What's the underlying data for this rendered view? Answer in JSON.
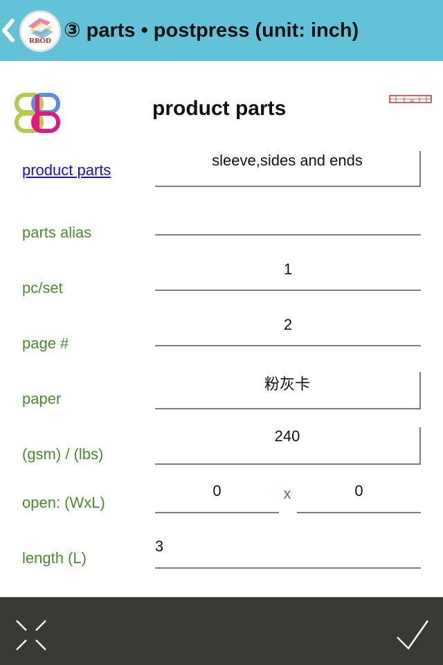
{
  "header": {
    "title": "③ parts • postpress (unit: inch)",
    "logo_text": "RBOD",
    "accent_color": "#62c2d7"
  },
  "content": {
    "page_title": "product parts"
  },
  "form": {
    "product_parts": {
      "label": "product parts",
      "value": "sleeve,sides and ends"
    },
    "parts_alias": {
      "label": "parts alias",
      "value": ""
    },
    "pc_per_set": {
      "label": "pc/set",
      "value": "1"
    },
    "page_count": {
      "label": "page #",
      "value": "2"
    },
    "paper": {
      "label": "paper",
      "value": "粉灰卡"
    },
    "weight": {
      "label": "(gsm) / (lbs)",
      "value": "240"
    },
    "open_size": {
      "label": "open: (WxL)",
      "width": "0",
      "separator": "x",
      "length": "0"
    },
    "length": {
      "label": "length (L)",
      "value": "3"
    }
  },
  "footer": {
    "background": "#3a3933",
    "cancel_icon": "close-x-icon",
    "confirm_icon": "checkmark-icon"
  }
}
